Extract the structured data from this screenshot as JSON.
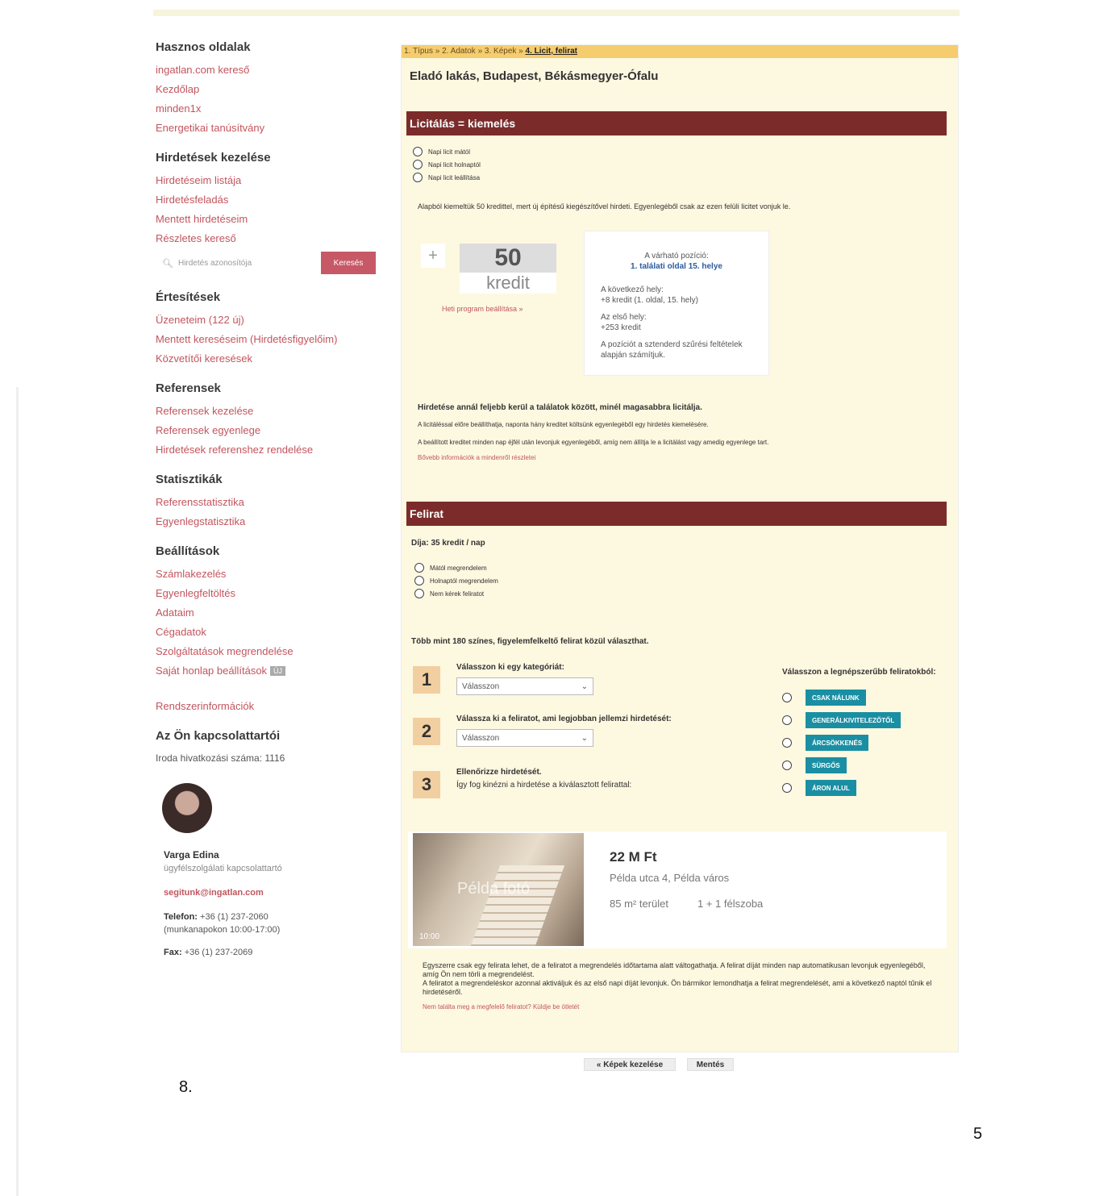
{
  "sidebar": {
    "useful": {
      "title": "Hasznos oldalak",
      "items": [
        "ingatlan.com kereső",
        "Kezdőlap",
        "minden1x",
        "Energetikai tanúsítvány"
      ]
    },
    "ads": {
      "title": "Hirdetések kezelése",
      "items": [
        "Hirdetéseim listája",
        "Hirdetésfeladás",
        "Mentett hirdetéseim",
        "Részletes kereső"
      ]
    },
    "search": {
      "placeholder": "Hirdetés azonosítója",
      "button": "Keresés"
    },
    "notifications": {
      "title": "Értesítések",
      "items": [
        "Üzeneteim (122 új)",
        "Mentett kereséseim (Hirdetésfigyelőim)",
        "Közvetítői keresések"
      ]
    },
    "referents": {
      "title": "Referensek",
      "items": [
        "Referensek kezelése",
        "Referensek egyenlege",
        "Hirdetések referenshez rendelése"
      ]
    },
    "stats": {
      "title": "Statisztikák",
      "items": [
        "Referensstatisztika",
        "Egyenlegstatisztika"
      ]
    },
    "settings": {
      "title": "Beállítások",
      "items": [
        "Számlakezelés",
        "Egyenlegfeltöltés",
        "Adataim",
        "Cégadatok",
        "Szolgáltatások megrendelése",
        "Saját honlap beállítások"
      ],
      "new_badge": "ÚJ",
      "system_info": "Rendszerinformációk"
    },
    "contacts": {
      "title": "Az Ön kapcsolattartói",
      "office": "Iroda hivatkozási száma: 1116",
      "name": "Varga Edina",
      "role": "ügyfélszolgálati kapcsolattartó",
      "email": "segitunk@ingatlan.com",
      "phone_label": "Telefon:",
      "phone": "+36 (1) 237-2060",
      "hours": "(munkanapokon 10:00-17:00)",
      "fax_label": "Fax:",
      "fax": "+36 (1) 237-2069"
    }
  },
  "page_number_left": "8.",
  "page_number_right": "5",
  "main": {
    "steps": {
      "s1": "1. Típus",
      "s2": "2. Adatok",
      "s3": "3. Képek",
      "s4": "4. Licit, felirat",
      "sep": "»"
    },
    "title": "Eladó lakás, Budapest, Békásmegyer-Ófalu",
    "licit": {
      "header": "Licitálás = kiemelés",
      "options": [
        "Napi licit mától",
        "Napi licit holnaptól",
        "Napi licit leállítása"
      ],
      "info": "Alapból kiemeltük 50 kredittel, mert új építésű kiegészítővel hirdeti. Egyenlegéből csak az ezen felüli licitet vonjuk le.",
      "plus": "+",
      "amount": "50",
      "unit": "kredit",
      "week_program": "Heti program beállítása »",
      "position_title": "A várható pozíció:",
      "position_value": "1. találati oldal 15. helye",
      "next_label": "A következő hely:",
      "next_value": "+8 kredit (1. oldal, 15. hely)",
      "first_label": "Az első hely:",
      "first_value": "+253 kredit",
      "note": "A pozíciót a sztenderd szűrési feltételek alapján számítjuk.",
      "lead": "Hirdetése annál feljebb kerül a találatok között, minél magasabbra licitálja.",
      "p1": "A licitáléssal előre beállíthatja, naponta hány kreditet költsünk egyenlegéből egy hirdetés kiemelésére.",
      "p2": "A beállított kreditet minden nap éjfél után levonjuk egyenlegéből, amíg nem állítja le a licitálást vagy amedig egyenlege tart.",
      "more": "Bővebb információk a mindenről részletei"
    },
    "felirat": {
      "header": "Felirat",
      "price": "Díja: 35 kredit / nap",
      "options": [
        "Mától megrendelem",
        "Holnaptól megrendelem",
        "Nem kérek feliratot"
      ],
      "lead": "Több mint 180 színes, figyelemfelkeltő felirat közül választhat.",
      "step1_title": "Válasszon ki egy kategóriát:",
      "step2_title": "Válassza ki a feliratot, ami legjobban jellemzi hirdetését:",
      "step3_title": "Ellenőrizze hirdetését.",
      "step3_text": "Így fog kinézni a hirdetése a kiválasztott felirattal:",
      "select_placeholder": "Válasszon",
      "popular_title": "Válasszon a legnépszerűbb feliratokból:",
      "tags": [
        "CSAK NÁLUNK",
        "GENERÁLKIVITELEZŐTŐL",
        "ÁRCSÖKKENÉS",
        "SÜRGŐS",
        "ÁRON ALUL"
      ],
      "listing": {
        "price": "22 M Ft",
        "address": "Példa utca 4, Példa város",
        "area": "85 m² terület",
        "rooms": "1 + 1 félszoba",
        "photo_label": "Példa fotó",
        "photo_time": "10:00"
      },
      "foot1": "Egyszerre csak egy felirata lehet, de a feliratot a megrendelés időtartama alatt váltogathatja. A felirat díját minden nap automatikusan levonjuk egyenlegéből, amíg Ön nem törli a megrendelést.",
      "foot2": "A feliratot a megrendeléskor azonnal aktiváljuk és az első napi díját levonjuk. Ön bármikor lemondhatja a felirat megrendelését, ami a következő naptól tűnik el hirdetéséről.",
      "foot_link": "Nem találta meg a megfelelő feliratot? Küldje be ötletét"
    },
    "back_button": "« Képek kezelése",
    "save_button": "Mentés"
  }
}
